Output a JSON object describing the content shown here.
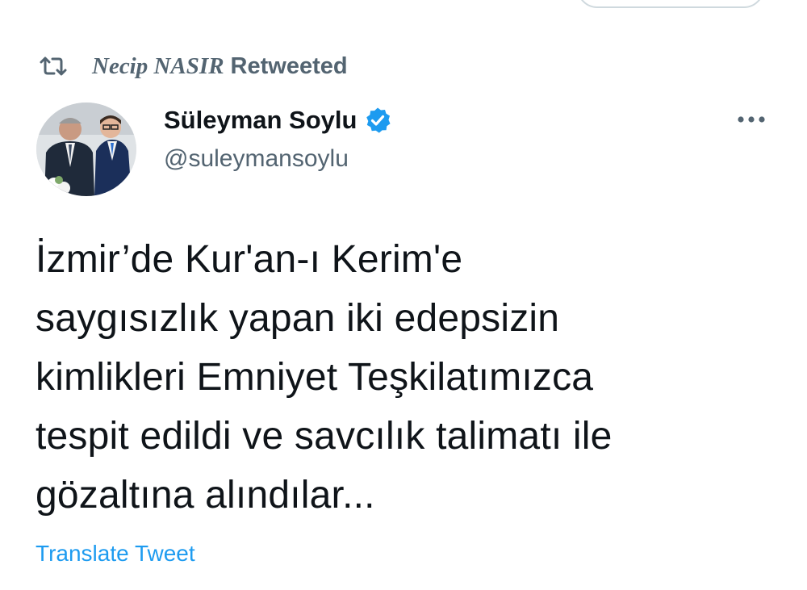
{
  "retweet": {
    "icon": "retweet-icon",
    "retweeter_name": "Necip NASIR",
    "label": "Retweeted"
  },
  "author": {
    "avatar": "profile-photo",
    "display_name": "Süleyman Soylu",
    "verified_icon": "verified-badge-icon",
    "handle": "@suleymansoylu"
  },
  "menu": {
    "icon": "more-options-icon"
  },
  "tweet": {
    "text": "İzmir’de Kur'an-ı Kerim'e\nsaygısızlık yapan iki edepsizin\nkimlikleri Emniyet Teşkilatımızca\ntespit edildi ve savcılık talimatı ile\ngözaltına alındılar...",
    "translate_label": "Translate Tweet"
  },
  "colors": {
    "primary_text": "#0f1419",
    "secondary_text": "#536471",
    "accent": "#1d9bf0",
    "border": "#cfd9de"
  }
}
